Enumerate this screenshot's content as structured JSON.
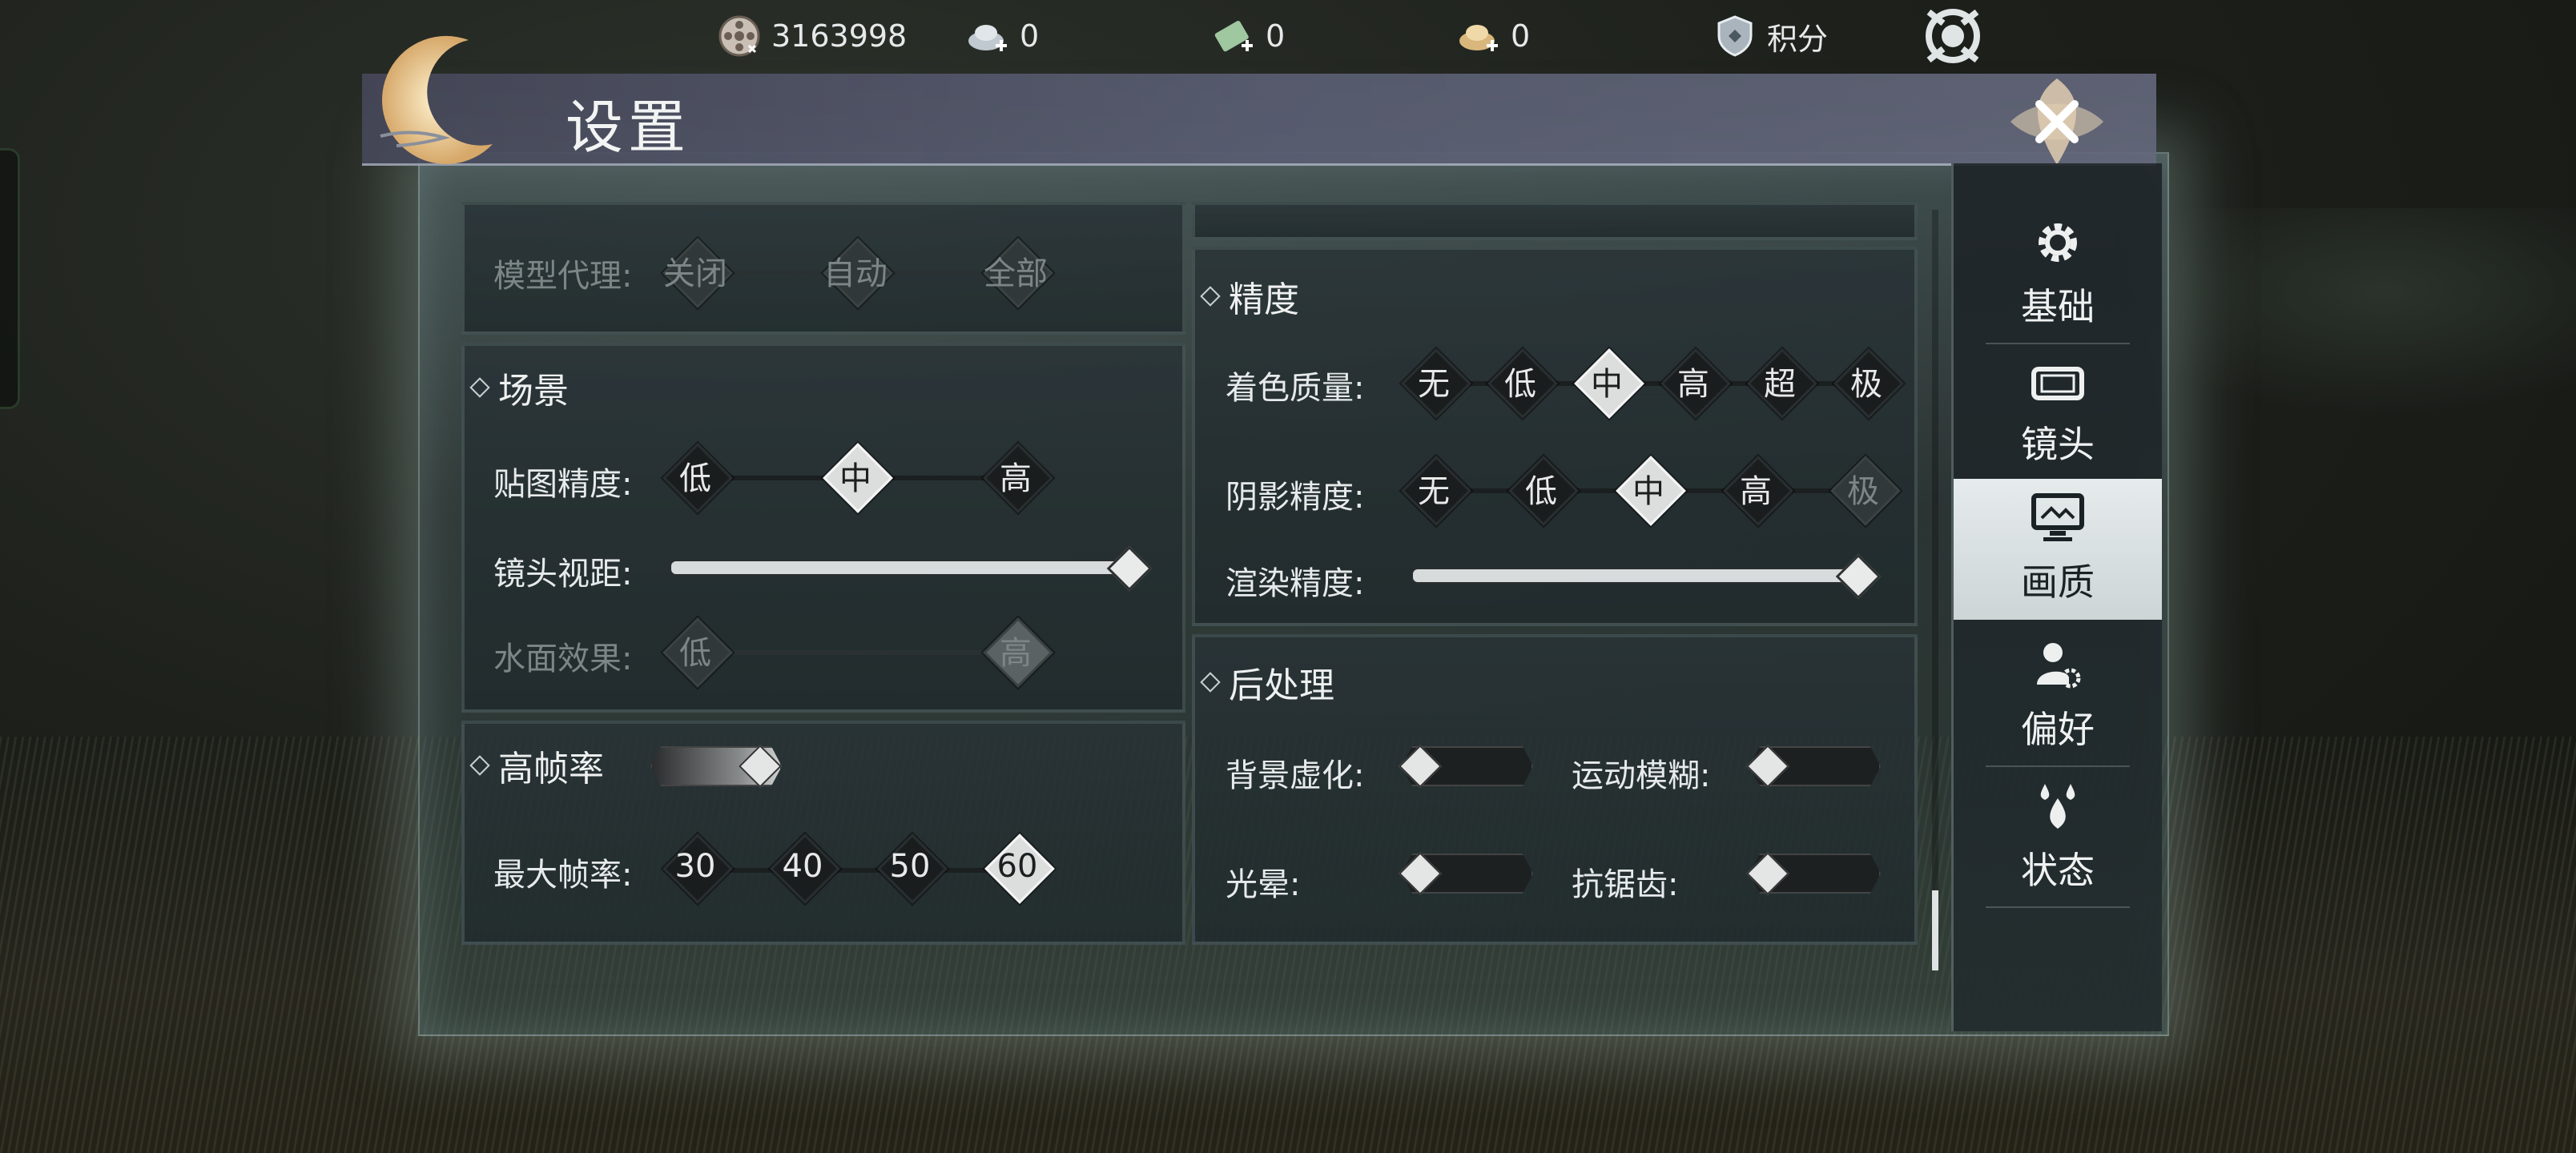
{
  "currency": [
    {
      "icon": "film-reel-icon",
      "value": "3163998"
    },
    {
      "icon": "silver-ingot-plus-icon",
      "value": "0"
    },
    {
      "icon": "green-ticket-plus-icon",
      "value": "0"
    },
    {
      "icon": "gold-ingot-plus-icon",
      "value": "0"
    },
    {
      "icon": "shield-icon",
      "value": "积分"
    }
  ],
  "window": {
    "title": "设置"
  },
  "left": {
    "model_proxy": {
      "label": "模型代理:",
      "options": [
        "关闭",
        "自动",
        "全部"
      ]
    },
    "scene": {
      "title": "场景",
      "texture": {
        "label": "贴图精度:",
        "options": [
          "低",
          "中",
          "高"
        ],
        "selected": 1
      },
      "view_distance": {
        "label": "镜头视距:",
        "level": 1.0
      },
      "water": {
        "label": "水面效果:",
        "options": [
          "低",
          "高"
        ],
        "selected": 1
      }
    },
    "fps": {
      "title": "高帧率",
      "enabled": true,
      "max": {
        "label": "最大帧率:",
        "options": [
          "30",
          "40",
          "50",
          "60"
        ],
        "selected": 3
      }
    }
  },
  "right": {
    "precision": {
      "title": "精度",
      "shading": {
        "label": "着色质量:",
        "options": [
          "无",
          "低",
          "中",
          "高",
          "超",
          "极"
        ],
        "selected": 2
      },
      "shadow": {
        "label": "阴影精度:",
        "options": [
          "无",
          "低",
          "中",
          "高",
          "极"
        ],
        "selected": 2
      },
      "render": {
        "label": "渲染精度:",
        "level": 1.0
      }
    },
    "post": {
      "title": "后处理",
      "bg_blur": "背景虚化:",
      "motion_blur": "运动模糊:",
      "bloom": "光晕:",
      "aa": "抗锯齿:"
    }
  },
  "tabs": [
    {
      "label": "基础",
      "icon": "gear-icon"
    },
    {
      "label": "镜头",
      "icon": "camera-icon"
    },
    {
      "label": "画质",
      "icon": "monitor-icon"
    },
    {
      "label": "偏好",
      "icon": "user-gear-icon"
    },
    {
      "label": "状态",
      "icon": "drops-icon"
    }
  ],
  "active_tab": 2
}
